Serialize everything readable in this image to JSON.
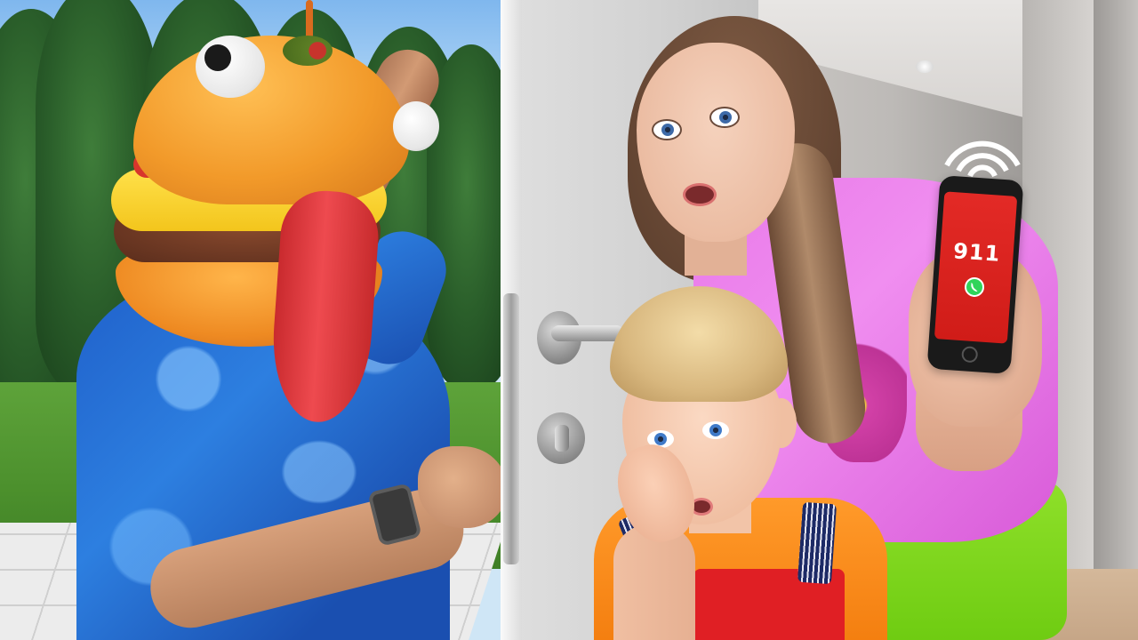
{
  "scene": {
    "phone_screen": {
      "number": "911",
      "screen_color": "#e32a26",
      "call_icon": "phone-call-icon"
    },
    "colors": {
      "man_shirt": "#2d7fe0",
      "burger_bun": "#f29a2a",
      "tongue": "#ee4a4f",
      "door": "#d2d2d2",
      "woman_shirt": "#f08ef0",
      "woman_pants": "#8fe02a",
      "boy_shirt": "#ff9a2a",
      "boy_overalls": "#e01f24"
    },
    "icons": [
      "wifi-signal-icon",
      "phone-call-icon"
    ]
  }
}
